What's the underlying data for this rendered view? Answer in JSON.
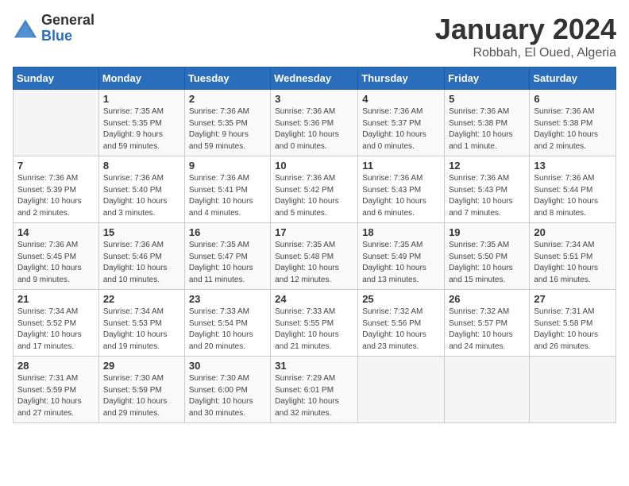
{
  "logo": {
    "general": "General",
    "blue": "Blue"
  },
  "calendar": {
    "title": "January 2024",
    "subtitle": "Robbah, El Oued, Algeria"
  },
  "headers": [
    "Sunday",
    "Monday",
    "Tuesday",
    "Wednesday",
    "Thursday",
    "Friday",
    "Saturday"
  ],
  "weeks": [
    [
      {
        "day": "",
        "info": ""
      },
      {
        "day": "1",
        "info": "Sunrise: 7:35 AM\nSunset: 5:35 PM\nDaylight: 9 hours\nand 59 minutes."
      },
      {
        "day": "2",
        "info": "Sunrise: 7:36 AM\nSunset: 5:35 PM\nDaylight: 9 hours\nand 59 minutes."
      },
      {
        "day": "3",
        "info": "Sunrise: 7:36 AM\nSunset: 5:36 PM\nDaylight: 10 hours\nand 0 minutes."
      },
      {
        "day": "4",
        "info": "Sunrise: 7:36 AM\nSunset: 5:37 PM\nDaylight: 10 hours\nand 0 minutes."
      },
      {
        "day": "5",
        "info": "Sunrise: 7:36 AM\nSunset: 5:38 PM\nDaylight: 10 hours\nand 1 minute."
      },
      {
        "day": "6",
        "info": "Sunrise: 7:36 AM\nSunset: 5:38 PM\nDaylight: 10 hours\nand 2 minutes."
      }
    ],
    [
      {
        "day": "7",
        "info": "Sunrise: 7:36 AM\nSunset: 5:39 PM\nDaylight: 10 hours\nand 2 minutes."
      },
      {
        "day": "8",
        "info": "Sunrise: 7:36 AM\nSunset: 5:40 PM\nDaylight: 10 hours\nand 3 minutes."
      },
      {
        "day": "9",
        "info": "Sunrise: 7:36 AM\nSunset: 5:41 PM\nDaylight: 10 hours\nand 4 minutes."
      },
      {
        "day": "10",
        "info": "Sunrise: 7:36 AM\nSunset: 5:42 PM\nDaylight: 10 hours\nand 5 minutes."
      },
      {
        "day": "11",
        "info": "Sunrise: 7:36 AM\nSunset: 5:43 PM\nDaylight: 10 hours\nand 6 minutes."
      },
      {
        "day": "12",
        "info": "Sunrise: 7:36 AM\nSunset: 5:43 PM\nDaylight: 10 hours\nand 7 minutes."
      },
      {
        "day": "13",
        "info": "Sunrise: 7:36 AM\nSunset: 5:44 PM\nDaylight: 10 hours\nand 8 minutes."
      }
    ],
    [
      {
        "day": "14",
        "info": "Sunrise: 7:36 AM\nSunset: 5:45 PM\nDaylight: 10 hours\nand 9 minutes."
      },
      {
        "day": "15",
        "info": "Sunrise: 7:36 AM\nSunset: 5:46 PM\nDaylight: 10 hours\nand 10 minutes."
      },
      {
        "day": "16",
        "info": "Sunrise: 7:35 AM\nSunset: 5:47 PM\nDaylight: 10 hours\nand 11 minutes."
      },
      {
        "day": "17",
        "info": "Sunrise: 7:35 AM\nSunset: 5:48 PM\nDaylight: 10 hours\nand 12 minutes."
      },
      {
        "day": "18",
        "info": "Sunrise: 7:35 AM\nSunset: 5:49 PM\nDaylight: 10 hours\nand 13 minutes."
      },
      {
        "day": "19",
        "info": "Sunrise: 7:35 AM\nSunset: 5:50 PM\nDaylight: 10 hours\nand 15 minutes."
      },
      {
        "day": "20",
        "info": "Sunrise: 7:34 AM\nSunset: 5:51 PM\nDaylight: 10 hours\nand 16 minutes."
      }
    ],
    [
      {
        "day": "21",
        "info": "Sunrise: 7:34 AM\nSunset: 5:52 PM\nDaylight: 10 hours\nand 17 minutes."
      },
      {
        "day": "22",
        "info": "Sunrise: 7:34 AM\nSunset: 5:53 PM\nDaylight: 10 hours\nand 19 minutes."
      },
      {
        "day": "23",
        "info": "Sunrise: 7:33 AM\nSunset: 5:54 PM\nDaylight: 10 hours\nand 20 minutes."
      },
      {
        "day": "24",
        "info": "Sunrise: 7:33 AM\nSunset: 5:55 PM\nDaylight: 10 hours\nand 21 minutes."
      },
      {
        "day": "25",
        "info": "Sunrise: 7:32 AM\nSunset: 5:56 PM\nDaylight: 10 hours\nand 23 minutes."
      },
      {
        "day": "26",
        "info": "Sunrise: 7:32 AM\nSunset: 5:57 PM\nDaylight: 10 hours\nand 24 minutes."
      },
      {
        "day": "27",
        "info": "Sunrise: 7:31 AM\nSunset: 5:58 PM\nDaylight: 10 hours\nand 26 minutes."
      }
    ],
    [
      {
        "day": "28",
        "info": "Sunrise: 7:31 AM\nSunset: 5:59 PM\nDaylight: 10 hours\nand 27 minutes."
      },
      {
        "day": "29",
        "info": "Sunrise: 7:30 AM\nSunset: 5:59 PM\nDaylight: 10 hours\nand 29 minutes."
      },
      {
        "day": "30",
        "info": "Sunrise: 7:30 AM\nSunset: 6:00 PM\nDaylight: 10 hours\nand 30 minutes."
      },
      {
        "day": "31",
        "info": "Sunrise: 7:29 AM\nSunset: 6:01 PM\nDaylight: 10 hours\nand 32 minutes."
      },
      {
        "day": "",
        "info": ""
      },
      {
        "day": "",
        "info": ""
      },
      {
        "day": "",
        "info": ""
      }
    ]
  ]
}
